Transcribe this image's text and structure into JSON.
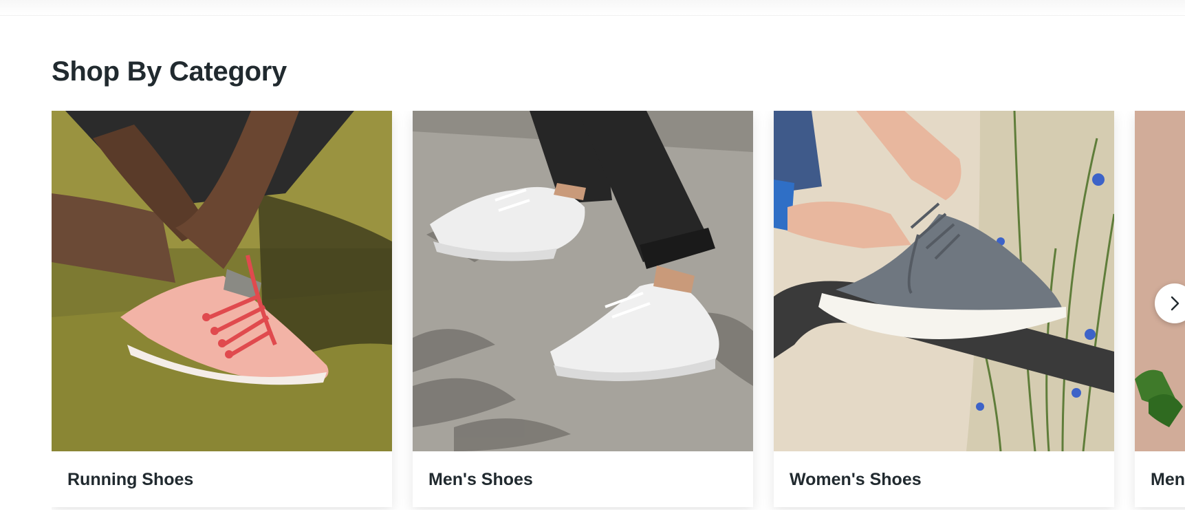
{
  "section": {
    "title": "Shop By Category"
  },
  "categories": [
    {
      "label": "Running Shoes"
    },
    {
      "label": "Men's Shoes"
    },
    {
      "label": "Women's Shoes"
    },
    {
      "label": "Men's Apparel"
    }
  ],
  "carousel": {
    "next_icon": "chevron-right-icon"
  },
  "colors": {
    "text": "#212a2f",
    "running_shoe": "#f2b3a6",
    "running_laces": "#e04a4e",
    "mens_shoe": "#eeeeee",
    "womens_shoe": "#6f7780",
    "grass": "#8a8a3a",
    "pavement": "#a6a39c"
  }
}
